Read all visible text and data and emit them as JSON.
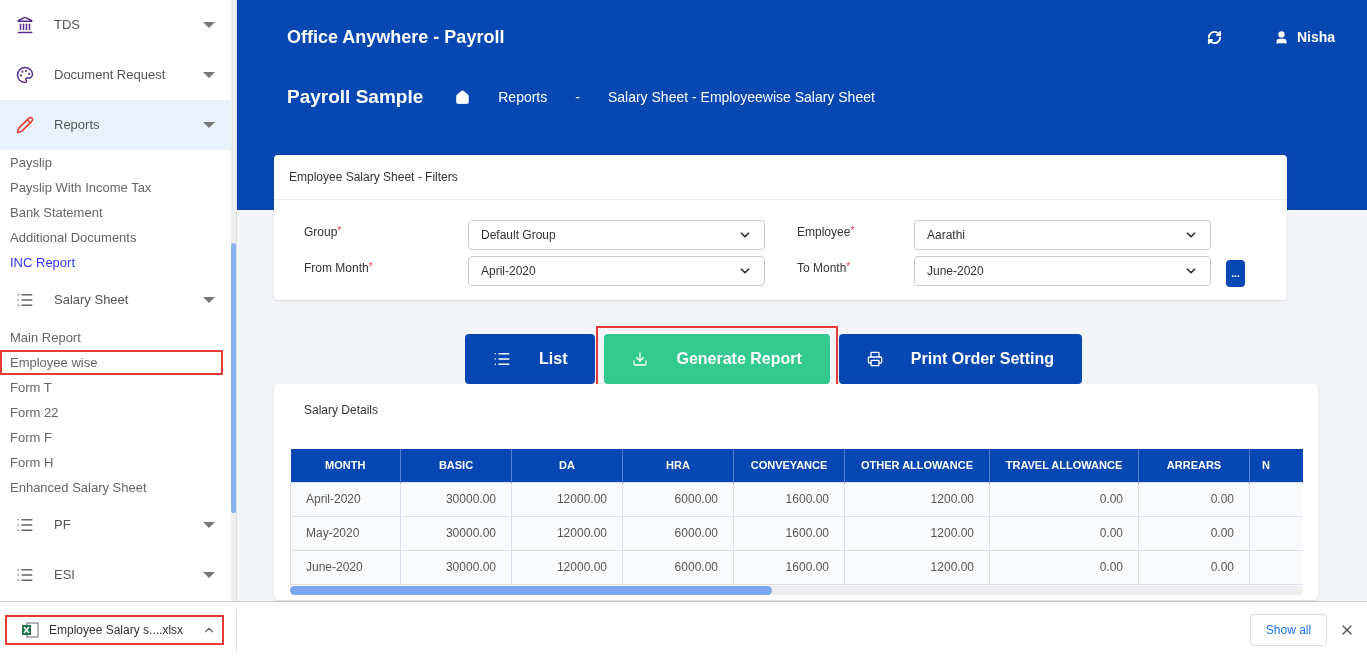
{
  "sidebar": {
    "items": [
      {
        "label": "TDS",
        "active": false
      },
      {
        "label": "Document Request",
        "active": false
      },
      {
        "label": "Reports",
        "active": true,
        "children": [
          {
            "label": "Payslip",
            "visited": false,
            "highlighted": false
          },
          {
            "label": "Payslip With Income Tax",
            "visited": false,
            "highlighted": false
          },
          {
            "label": "Bank Statement",
            "visited": false,
            "highlighted": false
          },
          {
            "label": "Additional Documents",
            "visited": false,
            "highlighted": false
          },
          {
            "label": "INC Report",
            "visited": true,
            "highlighted": false
          }
        ]
      },
      {
        "label": "Salary Sheet",
        "active": false,
        "children": [
          {
            "label": "Main Report",
            "visited": false,
            "highlighted": false
          },
          {
            "label": "Employee wise",
            "visited": false,
            "highlighted": true
          },
          {
            "label": "Form T",
            "visited": false,
            "highlighted": false
          },
          {
            "label": "Form 22",
            "visited": false,
            "highlighted": false
          },
          {
            "label": "Form F",
            "visited": false,
            "highlighted": false
          },
          {
            "label": "Form H",
            "visited": false,
            "highlighted": false
          },
          {
            "label": "Enhanced Salary Sheet",
            "visited": false,
            "highlighted": false
          }
        ]
      },
      {
        "label": "PF",
        "active": false
      },
      {
        "label": "ESI",
        "active": false
      }
    ]
  },
  "header": {
    "app_title": "Office Anywhere - Payroll",
    "user": "Nisha",
    "company": "Payroll Sample",
    "breadcrumb": [
      "Reports",
      "-",
      "Salary Sheet - Employeewise Salary Sheet"
    ]
  },
  "filters": {
    "title": "Employee Salary Sheet - Filters",
    "fields": [
      {
        "label": "Group",
        "required_mark": "*",
        "value": "Default Group"
      },
      {
        "label": "Employee",
        "required_mark": "*",
        "value": "Aarathi"
      },
      {
        "label": "From Month",
        "required_mark": "*",
        "value": "April-2020"
      },
      {
        "label": "To Month",
        "required_mark": "*",
        "value": "June-2020"
      }
    ],
    "more_button": "..."
  },
  "actions": [
    {
      "label": "List",
      "kind": "primary",
      "highlighted": false
    },
    {
      "label": "Generate Report",
      "kind": "success",
      "highlighted": true
    },
    {
      "label": "Print Order Setting",
      "kind": "primary",
      "highlighted": false
    }
  ],
  "salary_details": {
    "title": "Salary Details",
    "table": {
      "columns": [
        "MONTH",
        "BASIC",
        "DA",
        "HRA",
        "CONVEYANCE",
        "OTHER ALLOWANCE",
        "TRAVEL ALLOWANCE",
        "ARREARS",
        "N"
      ],
      "rows": [
        [
          "April-2020",
          "30000.00",
          "12000.00",
          "6000.00",
          "1600.00",
          "1200.00",
          "0.00",
          "0.00"
        ],
        [
          "May-2020",
          "30000.00",
          "12000.00",
          "6000.00",
          "1600.00",
          "1200.00",
          "0.00",
          "0.00"
        ],
        [
          "June-2020",
          "30000.00",
          "12000.00",
          "6000.00",
          "1600.00",
          "1200.00",
          "0.00",
          "0.00"
        ]
      ]
    }
  },
  "download_bar": {
    "file": "Employee Salary s....xlsx",
    "highlighted": true,
    "show_all": "Show all"
  }
}
